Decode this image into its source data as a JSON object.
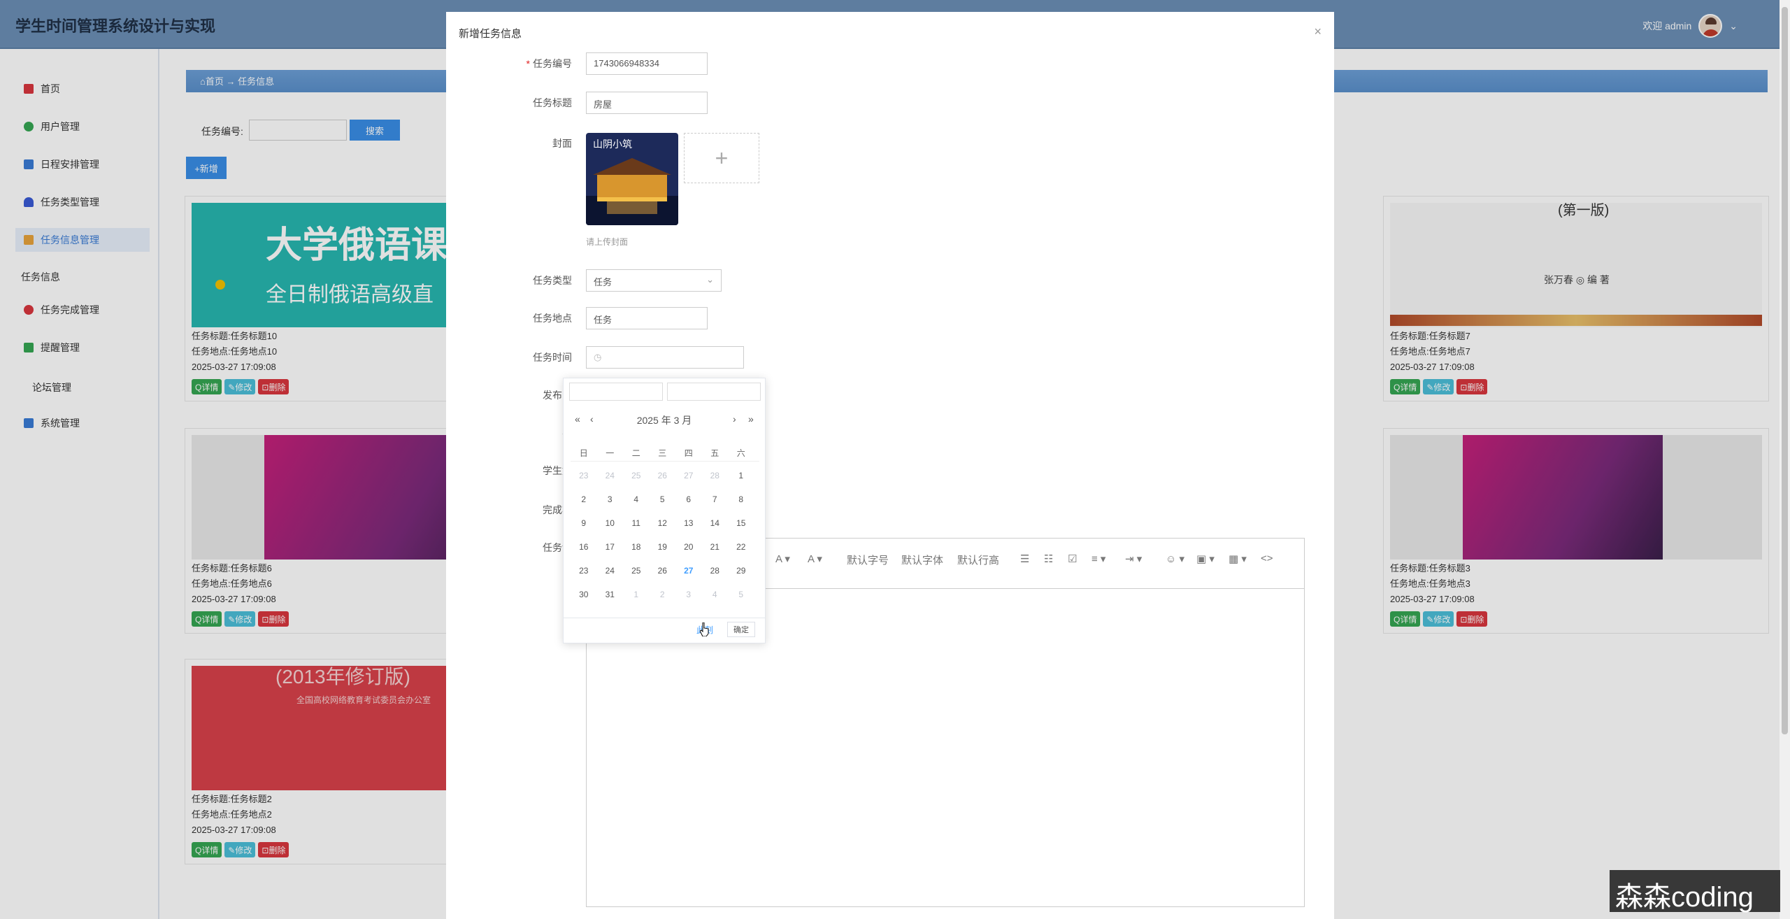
{
  "header": {
    "title": "学生时间管理系统设计与实现",
    "welcome": "欢迎 admin",
    "dropdown_arrow": "⌄"
  },
  "sidebar": {
    "items": [
      {
        "label": "首页",
        "icon": "home-icon",
        "color": "#d9363e"
      },
      {
        "label": "用户管理",
        "icon": "user-icon",
        "color": "#35a653"
      },
      {
        "label": "日程安排管理",
        "icon": "calendar-icon",
        "color": "#3a7bd5"
      },
      {
        "label": "任务类型管理",
        "icon": "tag-icon",
        "color": "#3a5bd5"
      },
      {
        "label": "任务信息管理",
        "icon": "folder-icon",
        "color": "#e8a33d"
      },
      {
        "label": "任务完成管理",
        "icon": "check-icon",
        "color": "#d9363e"
      },
      {
        "label": "提醒管理",
        "icon": "bell-icon",
        "color": "#35a653"
      },
      {
        "label": "系统管理",
        "icon": "gear-icon",
        "color": "#3a7bd5"
      }
    ],
    "heading": "任务信息",
    "forum": "论坛管理"
  },
  "breadcrumb": {
    "home": "⌂首页",
    "sep": "→",
    "current": "任务信息"
  },
  "search": {
    "label": "任务编号:",
    "button": "搜索"
  },
  "add_button": "+新增",
  "cards": [
    {
      "title": "任务标题:任务标题10",
      "place": "任务地点:任务地点10",
      "time": "2025-03-27 17:09:08",
      "img_text": "大学俄语课",
      "img_sub": "全日制俄语高级直"
    },
    {
      "title": "任务标题:任务标题7",
      "place": "任务地点:任务地点7",
      "time": "2025-03-27 17:09:08",
      "img_text": "(第一版)",
      "img_sub": "张万春 ◎ 编 著"
    },
    {
      "title": "任务标题:任务标题6",
      "place": "任务地点:任务地点6",
      "time": "2025-03-27 17:09:08"
    },
    {
      "title": "任务标题:任务标题3",
      "place": "任务地点:任务地点3",
      "time": "2025-03-27 17:09:08"
    },
    {
      "title": "任务标题:任务标题2",
      "place": "任务地点:任务地点2",
      "time": "2025-03-27 17:09:08",
      "img_text": "(2013年修订版)",
      "img_sub": "全国高校网络教育考试委员会办公室"
    }
  ],
  "card_actions": {
    "detail": "Q详情",
    "edit": "✎修改",
    "delete": "⊡删除"
  },
  "modal": {
    "title": "新增任务信息",
    "close": "×",
    "labels": {
      "code": "任务编号",
      "title": "任务标题",
      "cover": "封面",
      "type": "任务类型",
      "place": "任务地点",
      "time": "任务时间",
      "publish": "发布时",
      "student": "学",
      "student_name": "学生姓",
      "status": "完成状",
      "detail": "任务详"
    },
    "values": {
      "code": "1743066948334",
      "title": "房屋",
      "type": "任务",
      "place": "任务"
    },
    "cover_hint": "请上传封面",
    "cover_text": "山阴小筑",
    "add_symbol": "+",
    "time_icon": "◷"
  },
  "editor_toolbar": {
    "items": [
      "A ▾",
      "A ▾",
      "默认字号",
      "默认字体",
      "默认行高",
      "☰",
      "☷",
      "☑",
      "≡ ▾",
      "⇥ ▾",
      "☺ ▾",
      "▣ ▾",
      "▦ ▾",
      "<>"
    ]
  },
  "datepicker": {
    "year_month": "2025 年  3 月",
    "nav": {
      "prev_year": "«",
      "prev_month": "‹",
      "next_month": "›",
      "next_year": "»"
    },
    "weekdays": [
      "日",
      "一",
      "二",
      "三",
      "四",
      "五",
      "六"
    ],
    "rows": [
      [
        "23",
        "24",
        "25",
        "26",
        "27",
        "28",
        "1"
      ],
      [
        "2",
        "3",
        "4",
        "5",
        "6",
        "7",
        "8"
      ],
      [
        "9",
        "10",
        "11",
        "12",
        "13",
        "14",
        "15"
      ],
      [
        "16",
        "17",
        "18",
        "19",
        "20",
        "21",
        "22"
      ],
      [
        "23",
        "24",
        "25",
        "26",
        "27",
        "28",
        "29"
      ],
      [
        "30",
        "31",
        "1",
        "2",
        "3",
        "4",
        "5"
      ]
    ],
    "now": "此刻",
    "ok": "确定"
  },
  "watermark": "森森coding"
}
